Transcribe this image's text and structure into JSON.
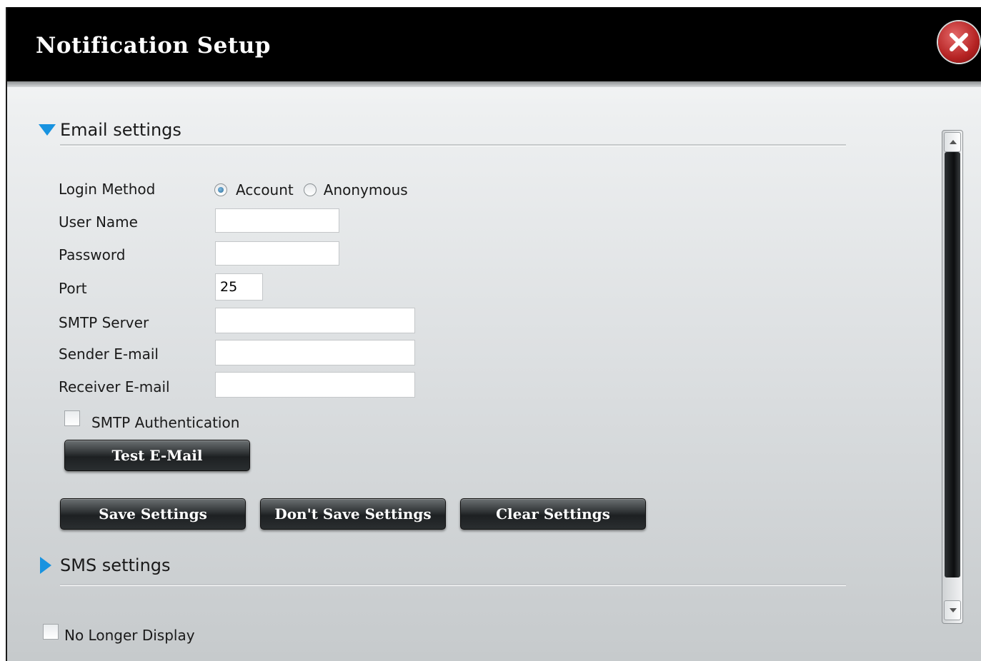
{
  "dialog": {
    "title": "Notification Setup",
    "close_icon": "close-x-icon"
  },
  "email_section": {
    "header": "Email settings",
    "expanded": true,
    "login_method": {
      "label": "Login Method",
      "options": [
        "Account",
        "Anonymous"
      ],
      "selected": "Account"
    },
    "user_name": {
      "label": "User Name",
      "value": ""
    },
    "password": {
      "label": "Password",
      "value": ""
    },
    "port": {
      "label": "Port",
      "value": "25"
    },
    "smtp_server": {
      "label": "SMTP Server",
      "value": ""
    },
    "sender_email": {
      "label": "Sender E-mail",
      "value": ""
    },
    "receiver_email": {
      "label": "Receiver E-mail",
      "value": ""
    },
    "smtp_auth": {
      "label": "SMTP Authentication",
      "checked": false
    },
    "test_button": "Test E-Mail"
  },
  "actions": {
    "save": "Save Settings",
    "dont_save": "Don't Save Settings",
    "clear": "Clear Settings"
  },
  "sms_section": {
    "header": "SMS settings",
    "expanded": false
  },
  "footer": {
    "no_longer_display": {
      "label": "No Longer Display",
      "checked": false
    }
  },
  "colors": {
    "titlebar": "#000000",
    "accent_triangle": "#1893e0",
    "close_button": "#b52323"
  }
}
